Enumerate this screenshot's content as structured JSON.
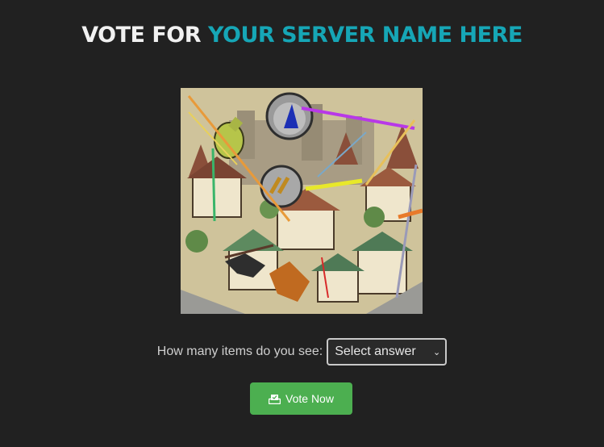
{
  "header": {
    "title_prefix": "VOTE FOR ",
    "server_name": "YOUR SERVER NAME HERE",
    "server_name_color": "#16a6b6"
  },
  "captcha": {
    "image_description_icon": "captcha-image"
  },
  "question": {
    "label": "How many items do you see:",
    "select_value": "Select answer",
    "select_icon": "chevron-down-icon"
  },
  "vote": {
    "label": "Vote Now",
    "icon": "vote-box-icon",
    "color": "#4caf50"
  }
}
